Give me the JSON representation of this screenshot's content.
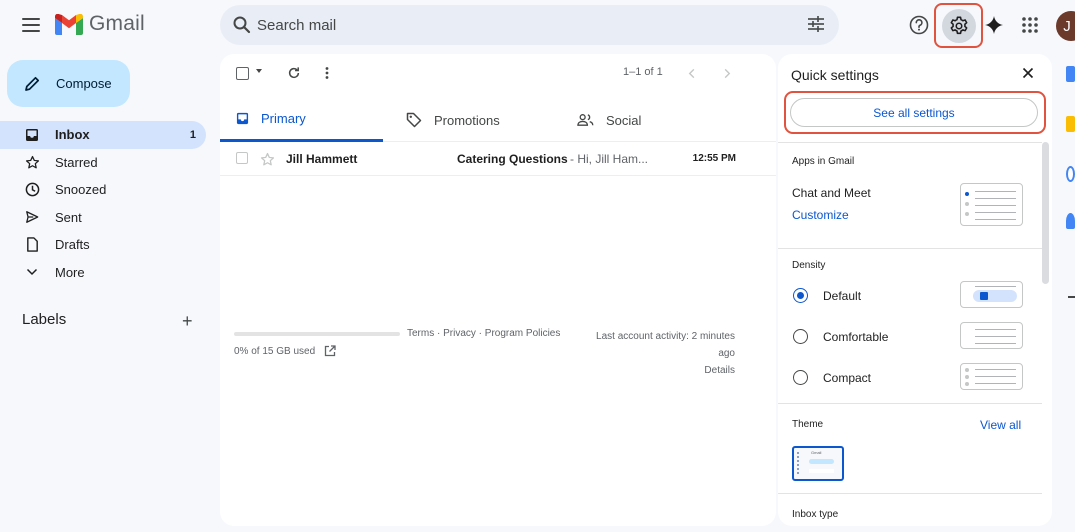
{
  "header": {
    "app_name": "Gmail",
    "search_placeholder": "Search mail",
    "avatar_letter": "J"
  },
  "sidebar": {
    "compose_label": "Compose",
    "items": [
      {
        "label": "Inbox",
        "count": "1",
        "icon": "inbox-icon"
      },
      {
        "label": "Starred",
        "icon": "star-icon"
      },
      {
        "label": "Snoozed",
        "icon": "clock-icon"
      },
      {
        "label": "Sent",
        "icon": "send-icon"
      },
      {
        "label": "Drafts",
        "icon": "draft-icon"
      },
      {
        "label": "More",
        "icon": "chevron-down-icon"
      }
    ],
    "labels_heading": "Labels"
  },
  "main": {
    "pager": "1–1 of 1",
    "tabs": [
      {
        "label": "Primary"
      },
      {
        "label": "Promotions"
      },
      {
        "label": "Social"
      }
    ],
    "emails": [
      {
        "sender": "Jill Hammett",
        "subject": "Catering Questions",
        "snippet": " - Hi, Jill Ham...",
        "time": "12:55 PM"
      }
    ],
    "storage": "0% of 15 GB used",
    "footer_links": "Terms · Privacy · Program Policies",
    "activity_line1": "Last account activity: 2 minutes",
    "activity_line2": "ago",
    "activity_details": "Details"
  },
  "quick_settings": {
    "title": "Quick settings",
    "see_all": "See all settings",
    "apps_heading": "Apps in Gmail",
    "chat_meet": "Chat and Meet",
    "customize": "Customize",
    "density_heading": "Density",
    "density_options": [
      {
        "label": "Default",
        "selected": true
      },
      {
        "label": "Comfortable",
        "selected": false
      },
      {
        "label": "Compact",
        "selected": false
      }
    ],
    "theme_heading": "Theme",
    "view_all": "View all",
    "inbox_type_heading": "Inbox type",
    "theme_thumb_label": "Gmail"
  },
  "colors": {
    "accent": "#0b57d0",
    "highlight": "#e0533f",
    "compose_bg": "#c2e7ff",
    "active_nav": "#d3e3fd"
  }
}
